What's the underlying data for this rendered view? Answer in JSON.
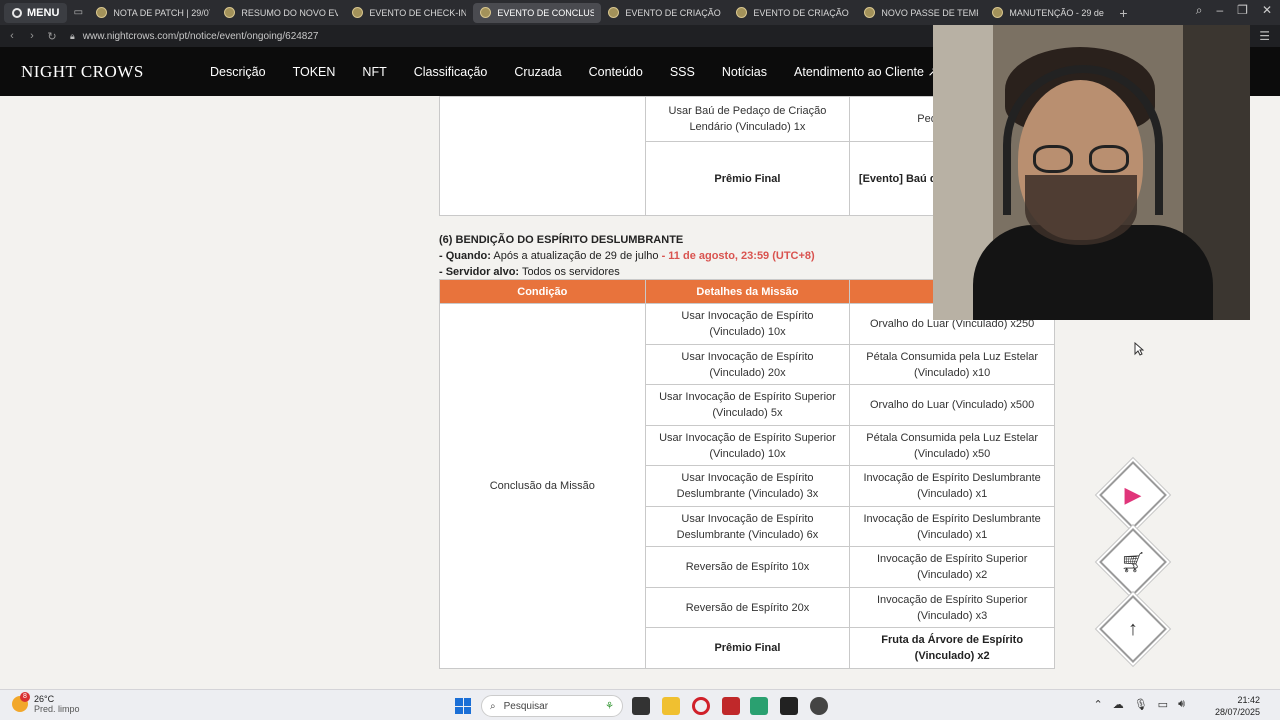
{
  "browser": {
    "menu_label": "MENU",
    "tabs": [
      {
        "title": "NOTA DE PATCH | 29/07/2",
        "active": false
      },
      {
        "title": "RESUMO DO NOVO EVEN",
        "active": false
      },
      {
        "title": "EVENTO DE CHECK-IN |",
        "active": false
      },
      {
        "title": "EVENTO DE CONCLUSÃ",
        "active": true
      },
      {
        "title": "EVENTO DE CRIAÇÃO DE",
        "active": false
      },
      {
        "title": "EVENTO DE CRIAÇÃO DE",
        "active": false
      },
      {
        "title": "NOVO PASSE DE TEMPO",
        "active": false
      },
      {
        "title": "MANUTENÇÃO - 29 de ju",
        "active": false
      }
    ],
    "url": "www.nightcrows.com/pt/notice/event/ongoing/624827"
  },
  "site": {
    "brand": "NIGHT CROWS",
    "nav": [
      "Descrição",
      "TOKEN",
      "NFT",
      "Classificação",
      "Cruzada",
      "Conteúdo",
      "SSS",
      "Notícias",
      "Atendimento ao Cliente ↗"
    ]
  },
  "top_table": {
    "rows": [
      {
        "detail": "Usar Baú de Pedaço de Criação Lendário (Vinculado) 1x",
        "reward": "Pedaço de Cé"
      },
      {
        "detail": "Prêmio Final",
        "reward": "[Evento] Baú de Elem Arma/Mo (Vin"
      }
    ]
  },
  "section6": {
    "title": "(6) BENDIÇÃO DO ESPÍRITO DESLUMBRANTE",
    "when_label": "- Quando:",
    "when_text": "Após a atualização de 29 de julho",
    "when_end": "- 11 de agosto, 23:59 (UTC+8)",
    "server_label": "- Servidor alvo:",
    "server_text": "Todos os servidores"
  },
  "main_table": {
    "headers": [
      "Condição",
      "Detalhes da Missão",
      "Re"
    ],
    "condition": "Conclusão da Missão",
    "rows": [
      {
        "detail": "Usar Invocação de Espírito (Vinculado) 10x",
        "reward": "Orvalho do Luar (Vinculado) x250"
      },
      {
        "detail": "Usar Invocação de Espírito (Vinculado) 20x",
        "reward": "Pétala Consumida pela Luz Estelar (Vinculado) x10"
      },
      {
        "detail": "Usar Invocação de Espírito Superior (Vinculado) 5x",
        "reward": "Orvalho do Luar (Vinculado) x500"
      },
      {
        "detail": "Usar Invocação de Espírito Superior (Vinculado) 10x",
        "reward": "Pétala Consumida pela Luz Estelar (Vinculado) x50"
      },
      {
        "detail": "Usar Invocação de Espírito Deslumbrante (Vinculado) 3x",
        "reward": "Invocação de Espírito Deslumbrante (Vinculado) x1"
      },
      {
        "detail": "Usar Invocação de Espírito Deslumbrante (Vinculado) 6x",
        "reward": "Invocação de Espírito Deslumbrante (Vinculado) x1"
      },
      {
        "detail": "Reversão de Espírito 10x",
        "reward": "Invocação de Espírito Superior (Vinculado) x2"
      },
      {
        "detail": "Reversão de Espírito 20x",
        "reward": "Invocação de Espírito Superior (Vinculado) x3"
      }
    ],
    "final_label": "Prêmio Final",
    "final_reward": "Fruta da Árvore de Espírito (Vinculado) x2"
  },
  "taskbar": {
    "weather_badge": "8",
    "temperature": "26°C",
    "condition": "Pred. limpo",
    "search_placeholder": "Pesquisar",
    "time": "21:42",
    "date": "28/07/2025"
  },
  "colors": {
    "table_header": "#e8733c",
    "highlight_red": "#d9534f",
    "site_header": "#0c0c0c"
  }
}
